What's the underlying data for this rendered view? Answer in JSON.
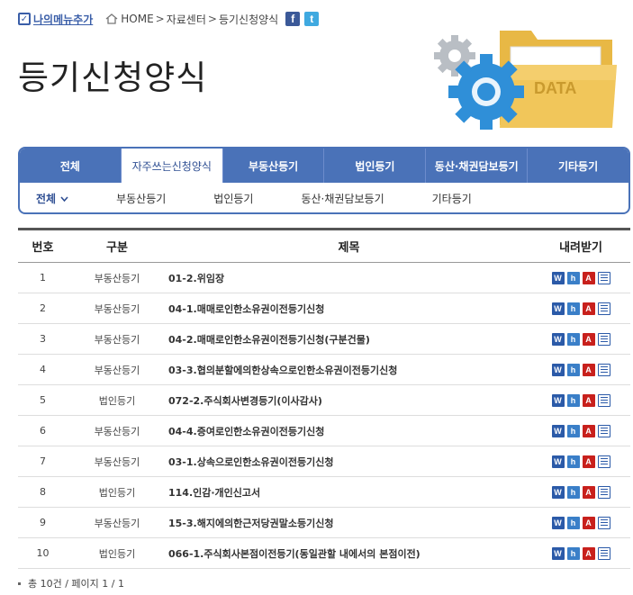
{
  "topbar": {
    "my_menu": "나의메뉴추가",
    "crumbs": [
      "HOME",
      "자료센터",
      "등기신청양식"
    ],
    "sep": ">",
    "facebook_glyph": "f",
    "twitter_glyph": "t"
  },
  "page_title": "등기신청양식",
  "illustration": {
    "folder_label": "DATA"
  },
  "tabs": [
    {
      "label": "전체"
    },
    {
      "label": "자주쓰는신청양식"
    },
    {
      "label": "부동산등기"
    },
    {
      "label": "법인등기"
    },
    {
      "label": "동산·채권담보등기"
    },
    {
      "label": "기타등기"
    }
  ],
  "subtabs": [
    {
      "label": "전체"
    },
    {
      "label": "부동산등기"
    },
    {
      "label": "법인등기"
    },
    {
      "label": "동산·채권담보등기"
    },
    {
      "label": "기타등기"
    }
  ],
  "table": {
    "headers": {
      "no": "번호",
      "cat": "구분",
      "title": "제목",
      "dl": "내려받기"
    },
    "rows": [
      {
        "no": "1",
        "cat": "부동산등기",
        "title": "01-2.위임장"
      },
      {
        "no": "2",
        "cat": "부동산등기",
        "title": "04-1.매매로인한소유권이전등기신청"
      },
      {
        "no": "3",
        "cat": "부동산등기",
        "title": "04-2.매매로인한소유권이전등기신청(구분건물)"
      },
      {
        "no": "4",
        "cat": "부동산등기",
        "title": "03-3.협의분할에의한상속으로인한소유권이전등기신청"
      },
      {
        "no": "5",
        "cat": "법인등기",
        "title": "072-2.주식회사변경등기(이사감사)"
      },
      {
        "no": "6",
        "cat": "부동산등기",
        "title": "04-4.증여로인한소유권이전등기신청"
      },
      {
        "no": "7",
        "cat": "부동산등기",
        "title": "03-1.상속으로인한소유권이전등기신청"
      },
      {
        "no": "8",
        "cat": "법인등기",
        "title": "114.인감·개인신고서"
      },
      {
        "no": "9",
        "cat": "부동산등기",
        "title": "15-3.해지에의한근저당권말소등기신청"
      },
      {
        "no": "10",
        "cat": "법인등기",
        "title": "066-1.주식회사본점이전등기(동일관할 내에서의 본점이전)"
      }
    ],
    "download_icons": [
      "word-icon",
      "hwp-icon",
      "pdf-icon",
      "text-file-icon"
    ],
    "icon_glyphs": {
      "word": "W",
      "hwp": "h",
      "pdf": "A"
    }
  },
  "footer": "총 10건 / 페이지 1 / 1",
  "colors": {
    "accent": "#4a72b8",
    "title_text": "#222222",
    "pdf": "#c8201c"
  }
}
